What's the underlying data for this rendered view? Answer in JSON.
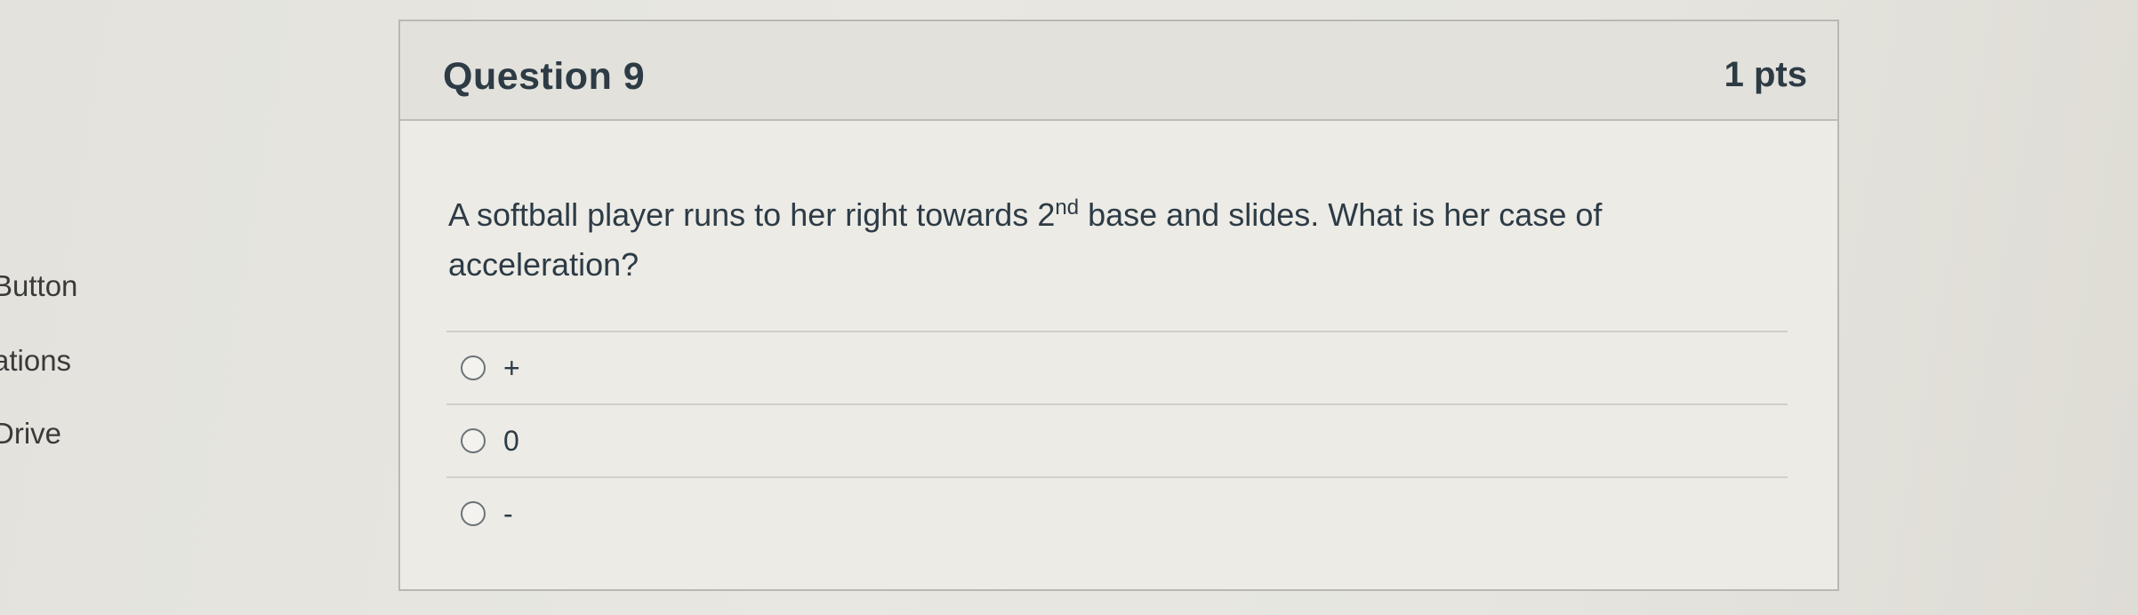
{
  "sidebar": {
    "items": [
      {
        "label": "Button"
      },
      {
        "label": "ations"
      },
      {
        "label": "Drive"
      }
    ]
  },
  "question": {
    "title": "Question 9",
    "points": "1 pts",
    "text_before": "A softball player runs to her right towards 2",
    "text_sup": "nd",
    "text_after": " base and slides. What is her case of acceleration?",
    "answers": [
      {
        "label": "+"
      },
      {
        "label": "0"
      },
      {
        "label": "-"
      }
    ]
  },
  "colors": {
    "background": "#e6e5df",
    "header_bg": "#e2e1dc",
    "text": "#2d3b45",
    "border": "#b9b8b3"
  }
}
